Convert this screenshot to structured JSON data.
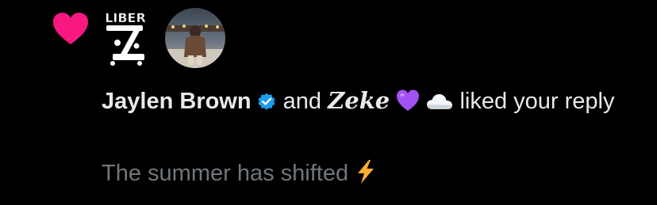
{
  "notification": {
    "type_icon": "heart-icon",
    "accent_color": "#f91880",
    "avatars": [
      {
        "icon": "liber-logo-avatar",
        "logo_text": "LIBER"
      },
      {
        "icon": "user-photo-avatar"
      }
    ],
    "actor_primary": "Jaylen Brown",
    "actor_primary_verified": true,
    "verified_color": "#1d9bf0",
    "connector": "and",
    "actor_secondary": "Zeke",
    "actor_secondary_emojis": [
      "purple-heart-emoji",
      "cloud-emoji"
    ],
    "action_text": "liked your reply",
    "tweet_preview": "The summer has shifted",
    "tweet_preview_emoji": "lightning-emoji"
  }
}
